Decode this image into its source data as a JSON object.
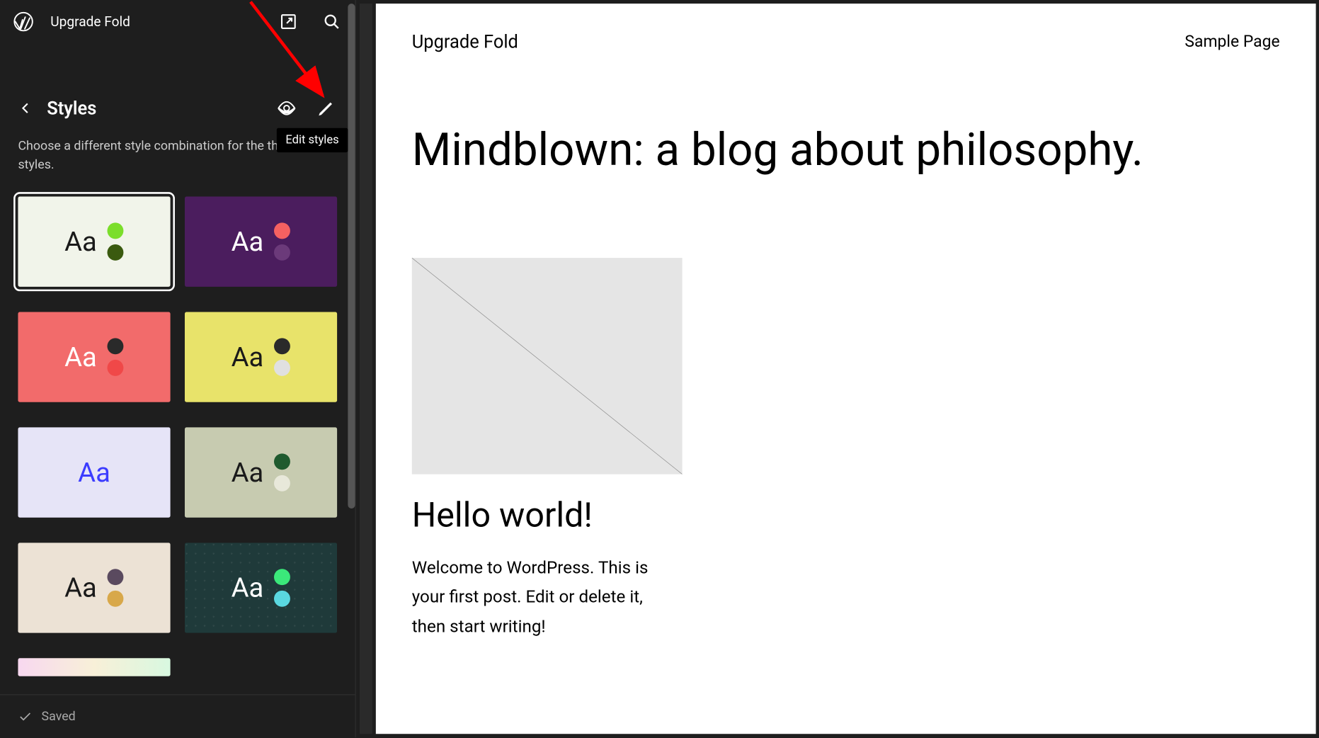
{
  "topbar": {
    "site_name": "Upgrade Fold"
  },
  "styles_panel": {
    "title": "Styles",
    "description": "Choose a different style combination for the theme styles.",
    "tooltip_edit": "Edit styles"
  },
  "style_cards": [
    {
      "bg": "#f1f4ea",
      "text_color": "#1a1a1a",
      "dot1": "#7bde2b",
      "dot2": "#3a5a0f",
      "aa": "Aa",
      "selected": true
    },
    {
      "bg": "#4b1d5e",
      "text_color": "#ffffff",
      "dot1": "#f56161",
      "dot2": "#6b3a7a",
      "aa": "Aa",
      "selected": false
    },
    {
      "bg": "#f26b6b",
      "text_color": "#ffffff",
      "dot1": "#2a2a2a",
      "dot2": "#f04848",
      "aa": "Aa",
      "selected": false
    },
    {
      "bg": "#e8e36a",
      "text_color": "#1a1a1a",
      "dot1": "#2a2a2a",
      "dot2": "#e0e0e0",
      "aa": "Aa",
      "selected": false
    },
    {
      "bg": "#e6e4f7",
      "text_color": "#3c3cff",
      "dot1": "",
      "dot2": "",
      "aa": "Aa",
      "selected": false
    },
    {
      "bg": "#c7cbb0",
      "text_color": "#1a1a1a",
      "dot1": "#1f5a2e",
      "dot2": "#e8e8da",
      "aa": "Aa",
      "selected": false
    },
    {
      "bg": "#ece2d5",
      "text_color": "#1a1a1a",
      "dot1": "#5a4a5f",
      "dot2": "#d8a84a",
      "aa": "Aa",
      "selected": false
    },
    {
      "bg": "#1f3a3a",
      "text_color": "#ffffff",
      "dot1": "#3be87a",
      "dot2": "#5ad8e0",
      "aa": "Aa",
      "selected": false,
      "pattern": true
    },
    {
      "bg": "",
      "text_color": "",
      "dot1": "",
      "dot2": "",
      "aa": "",
      "selected": false,
      "gradient": true
    }
  ],
  "status": {
    "saved_label": "Saved"
  },
  "preview": {
    "site_title": "Upgrade Fold",
    "nav_link": "Sample Page",
    "main_heading": "Mindblown: a blog about philosophy.",
    "post_title": "Hello world!",
    "post_body": "Welcome to WordPress. This is your first post. Edit or delete it, then start writing!"
  }
}
